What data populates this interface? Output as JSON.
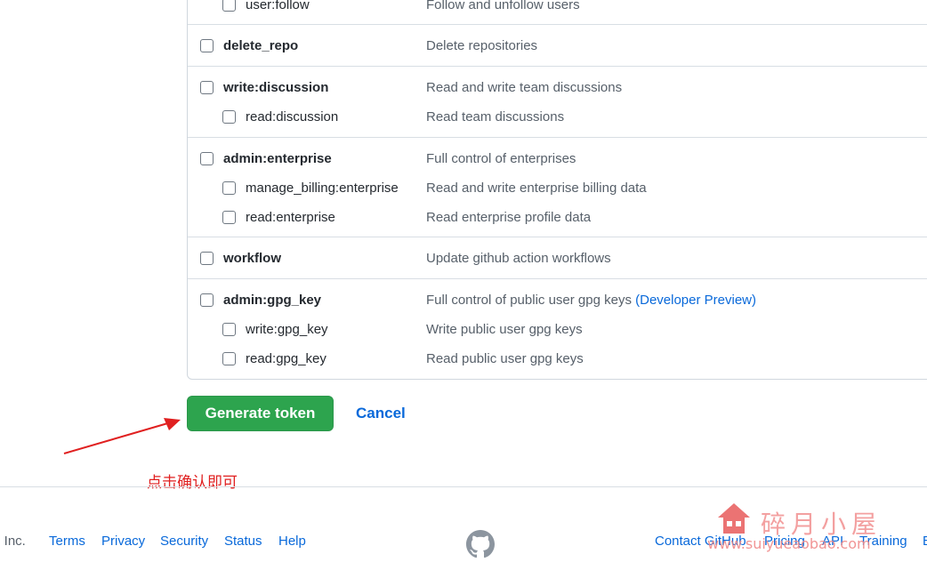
{
  "scopes": [
    {
      "rows": [
        {
          "name": "user:follow",
          "desc": "Follow and unfollow users",
          "level": "child"
        }
      ]
    },
    {
      "rows": [
        {
          "name": "delete_repo",
          "desc": "Delete repositories",
          "level": "parent"
        }
      ]
    },
    {
      "rows": [
        {
          "name": "write:discussion",
          "desc": "Read and write team discussions",
          "level": "parent"
        },
        {
          "name": "read:discussion",
          "desc": "Read team discussions",
          "level": "child"
        }
      ]
    },
    {
      "rows": [
        {
          "name": "admin:enterprise",
          "desc": "Full control of enterprises",
          "level": "parent"
        },
        {
          "name": "manage_billing:enterprise",
          "desc": "Read and write enterprise billing data",
          "level": "child"
        },
        {
          "name": "read:enterprise",
          "desc": "Read enterprise profile data",
          "level": "child"
        }
      ]
    },
    {
      "rows": [
        {
          "name": "workflow",
          "desc": "Update github action workflows",
          "level": "parent"
        }
      ]
    },
    {
      "rows": [
        {
          "name": "admin:gpg_key",
          "desc": "Full control of public user gpg keys",
          "desc_link": "(Developer Preview)",
          "level": "parent"
        },
        {
          "name": "write:gpg_key",
          "desc": "Write public user gpg keys",
          "level": "child"
        },
        {
          "name": "read:gpg_key",
          "desc": "Read public user gpg keys",
          "level": "child"
        }
      ]
    }
  ],
  "actions": {
    "generate_label": "Generate token",
    "cancel_label": "Cancel"
  },
  "annotation": {
    "text": "点击确认即可",
    "color": "#e02020"
  },
  "footer": {
    "copyright": "b, Inc.",
    "left_links": [
      "Terms",
      "Privacy",
      "Security",
      "Status",
      "Help"
    ],
    "right_links": [
      "Contact GitHub",
      "Pricing",
      "API",
      "Training",
      "B"
    ],
    "logo_icon": "github-mark-icon"
  },
  "watermark": {
    "title": "碎月小屋",
    "url": "www.suiyueaobao.com",
    "icon": "house-icon"
  },
  "colors": {
    "primary_button": "#2da44e",
    "link": "#0969da",
    "border": "#d0d7de"
  }
}
